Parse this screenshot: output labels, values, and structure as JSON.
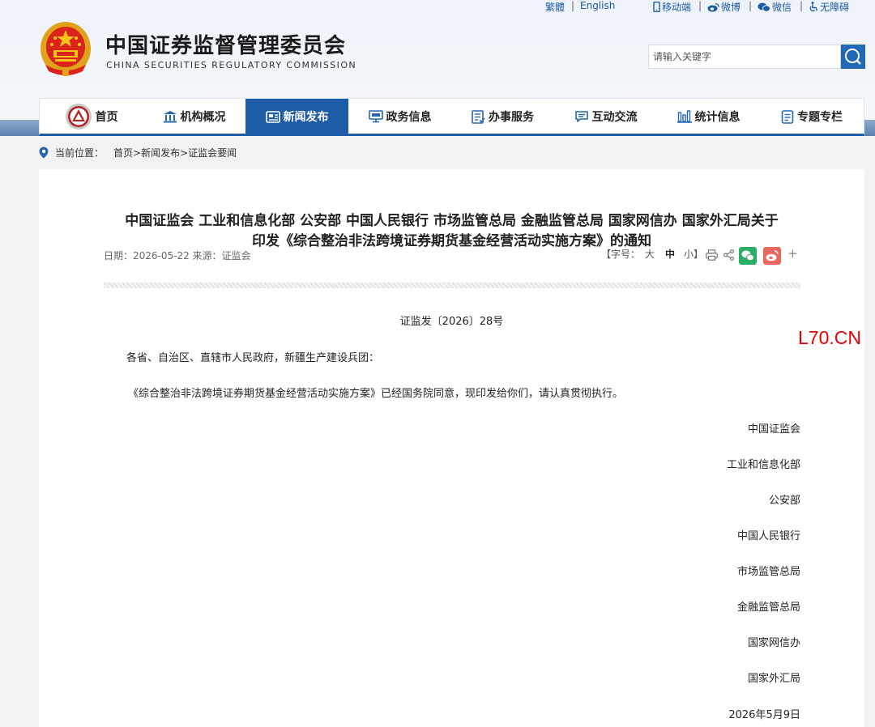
{
  "top_links": {
    "traditional": "繁體",
    "english": "English",
    "mobile": "移动端",
    "weibo": "微博",
    "wechat": "微信",
    "accessibility": "无障碍",
    "separator": "|"
  },
  "header": {
    "title": "中国证券监督管理委员会",
    "subtitle": "CHINA SECURITIES REGULATORY COMMISSION"
  },
  "search": {
    "placeholder": "请输入关键字"
  },
  "nav": {
    "items": [
      {
        "label": "首页",
        "icon": "csrc-logo-icon",
        "active": false
      },
      {
        "label": "机构概况",
        "icon": "building-icon",
        "active": false
      },
      {
        "label": "新闻发布",
        "icon": "newspaper-icon",
        "active": true
      },
      {
        "label": "政务信息",
        "icon": "monitor-icon",
        "active": false
      },
      {
        "label": "办事服务",
        "icon": "checklist-icon",
        "active": false
      },
      {
        "label": "互动交流",
        "icon": "chat-icon",
        "active": false
      },
      {
        "label": "统计信息",
        "icon": "bar-chart-icon",
        "active": false
      },
      {
        "label": "专题专栏",
        "icon": "document-icon",
        "active": false
      }
    ]
  },
  "breadcrumb": {
    "label": "当前位置：",
    "path": "首页>新闻发布>证监会要闻"
  },
  "article": {
    "title_line1": "中国证监会 工业和信息化部 公安部 中国人民银行 市场监管总局 金融监管总局 国家网信办 国家外汇局关于",
    "title_line2": "印发《综合整治非法跨境证券期货基金经营活动实施方案》的通知",
    "meta": "日期：2026-05-22 来源：证监会",
    "font_size_label": "【字号：",
    "font_large": "大",
    "font_medium": "中",
    "font_small": "小】",
    "more": "+",
    "doc_number": "证监发〔2026〕28号",
    "salutation": "各省、自治区、直辖市人民政府，新疆生产建设兵团：",
    "body": "《综合整治非法跨境证券期货基金经营活动实施方案》已经国务院同意，现印发给你们，请认真贯彻执行。",
    "signatories": [
      "中国证监会",
      "工业和信息化部",
      "公安部",
      "中国人民银行",
      "市场监管总局",
      "金融监管总局",
      "国家网信办",
      "国家外汇局"
    ],
    "date": "2026年5月9日"
  },
  "watermark": "L70.CN",
  "colors": {
    "brand_blue": "#1f5ca8",
    "link_blue": "#1c5aa6",
    "wechat_green": "#2aae67",
    "weibo_red": "#e86a5f",
    "watermark_red": "#e60000"
  }
}
